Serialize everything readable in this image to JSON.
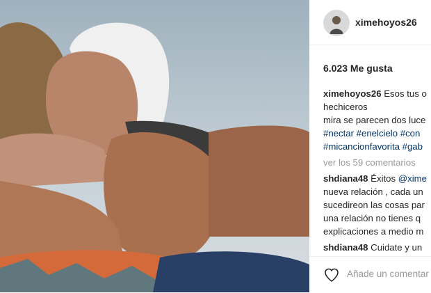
{
  "post": {
    "username": "ximehoyos26",
    "likes": "6.023 Me gusta",
    "caption": {
      "username": "ximehoyos26",
      "line1": " Esos tus o",
      "line2": "hechiceros",
      "line3": "mira se parecen dos luce",
      "tags_line1": [
        "#nectar",
        "#enelcielo",
        "#con"
      ],
      "tags_line2": [
        "#micancionfavorita",
        "#gab"
      ]
    },
    "view_comments": "ver los 59 comentarios",
    "comments": [
      {
        "username": "shdiana48",
        "lines": [
          " Éxitos ",
          "nueva relación , cada un",
          "sucedireon las cosas par",
          "una relación no tienes q",
          "explicaciones a medio m"
        ],
        "mention": "@xime"
      },
      {
        "username": "shdiana48",
        "text": " Cuidate y un"
      }
    ],
    "add_comment_placeholder": "Añade un comentar"
  },
  "icons": {
    "heart": "heart-outline-icon",
    "avatar": "avatar-image"
  }
}
